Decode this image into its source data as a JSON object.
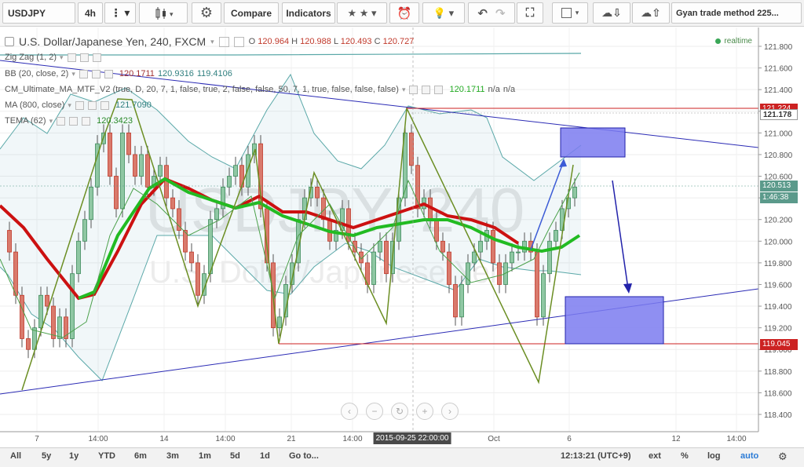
{
  "toolbar": {
    "symbol": "USDJPY",
    "interval": "4h",
    "compare_label": "Compare",
    "indicators_label": "Indicators",
    "layout_name": "Gyan trade method 225..."
  },
  "legend": {
    "title": "U.S. Dollar/Japanese Yen, 240, FXCM",
    "open_label": "O",
    "open": "120.964",
    "high_label": "H",
    "high": "120.988",
    "low_label": "L",
    "low": "120.493",
    "close_label": "C",
    "close": "120.727",
    "realtime": "realtime",
    "indicators": [
      {
        "name": "Zig Zag (1, 2)",
        "values": []
      },
      {
        "name": "BB (20, close, 2)",
        "values": [
          "120.1711",
          "120.9316",
          "119.4106"
        ]
      },
      {
        "name": "CM_Ultimate_MA_MTF_V2 (true, D, 20, 7, 1, false, true, 2, false, false, 50, 7, 1, true, false, false, false)",
        "values": [
          "120.1711",
          "n/a",
          "n/a"
        ]
      },
      {
        "name": "MA (800, close)",
        "values": [
          "121.7090"
        ]
      },
      {
        "name": "TEMA (62)",
        "values": [
          "120.3423"
        ]
      }
    ]
  },
  "watermark": {
    "symbol": "USDJPY, 240",
    "name": "U.S. Dollar/Japanese Yen"
  },
  "price_axis": {
    "ticks": [
      "121.800",
      "121.600",
      "121.400",
      "121.200",
      "121.000",
      "120.800",
      "120.600",
      "120.400",
      "120.200",
      "120.000",
      "119.800",
      "119.600",
      "119.400",
      "119.200",
      "119.000",
      "118.800",
      "118.600",
      "118.400"
    ],
    "tag_high": "121.224",
    "tag_high2": "121.178",
    "tag_last": "120.513",
    "tag_countdown": "1:46:38",
    "tag_low": "119.045"
  },
  "time_axis": {
    "labels": [
      "7",
      "14:00",
      "14",
      "14:00",
      "21",
      "14:00",
      "2015-09-25 22:00:00",
      "Oct",
      "6",
      "12",
      "14:00"
    ]
  },
  "bottom": {
    "ranges": [
      "All",
      "5y",
      "1y",
      "YTD",
      "6m",
      "3m",
      "1m",
      "5d",
      "1d"
    ],
    "goto": "Go to...",
    "clock": "12:13:21 (UTC+9)",
    "ext": "ext",
    "pct": "%",
    "log": "log",
    "auto": "auto"
  },
  "colors": {
    "up": "#3d8a5a",
    "down": "#c0392b",
    "trend": "#2b2bb5",
    "box": "#7b7bf0",
    "zigzag": "#6b8e23",
    "bb": "#5aa8a8",
    "ma_red": "#cc1111",
    "ma_green": "#22bb22",
    "level": "#cc2222"
  }
}
